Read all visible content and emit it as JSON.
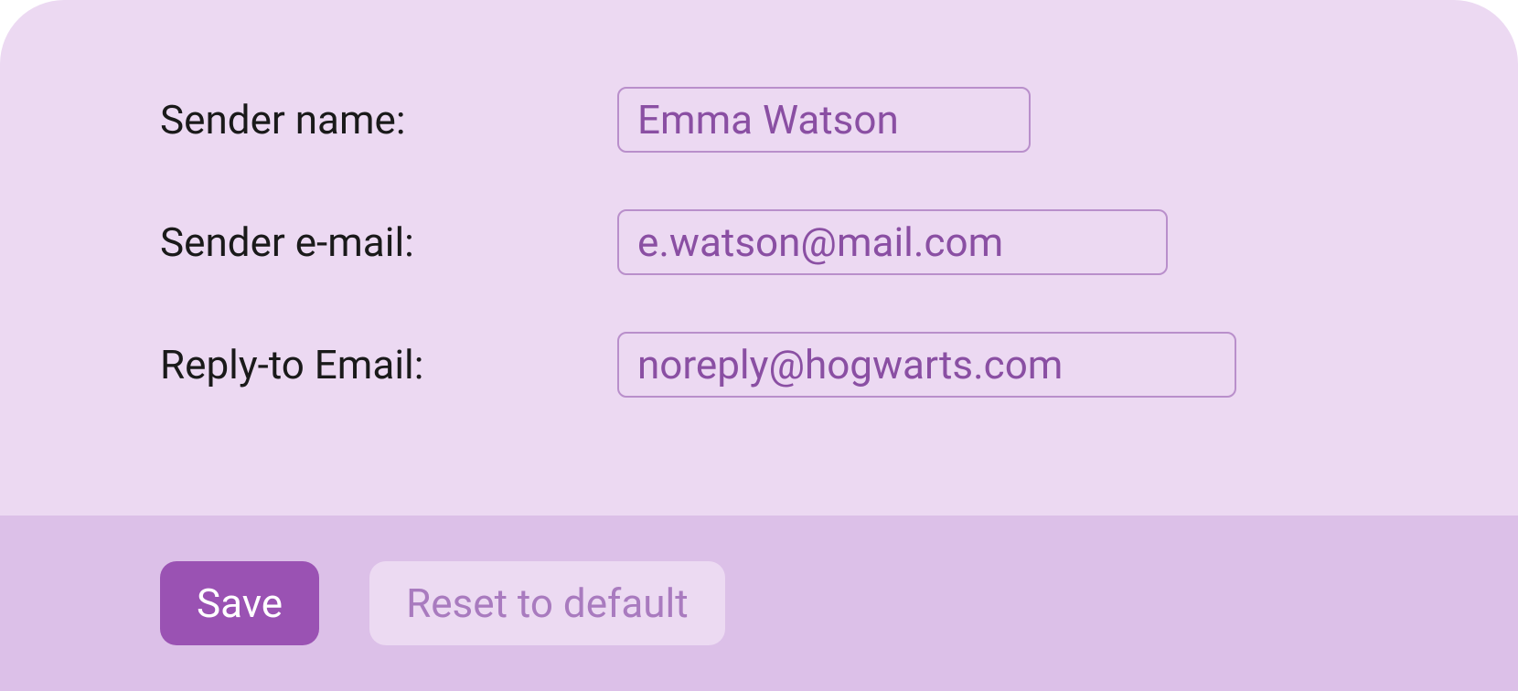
{
  "form": {
    "sender_name": {
      "label": "Sender name:",
      "value": "Emma Watson"
    },
    "sender_email": {
      "label": "Sender e-mail:",
      "value": "e.watson@mail.com"
    },
    "reply_to_email": {
      "label": "Reply-to Email:",
      "value": "noreply@hogwarts.com"
    }
  },
  "actions": {
    "save_label": "Save",
    "reset_label": "Reset to default"
  }
}
